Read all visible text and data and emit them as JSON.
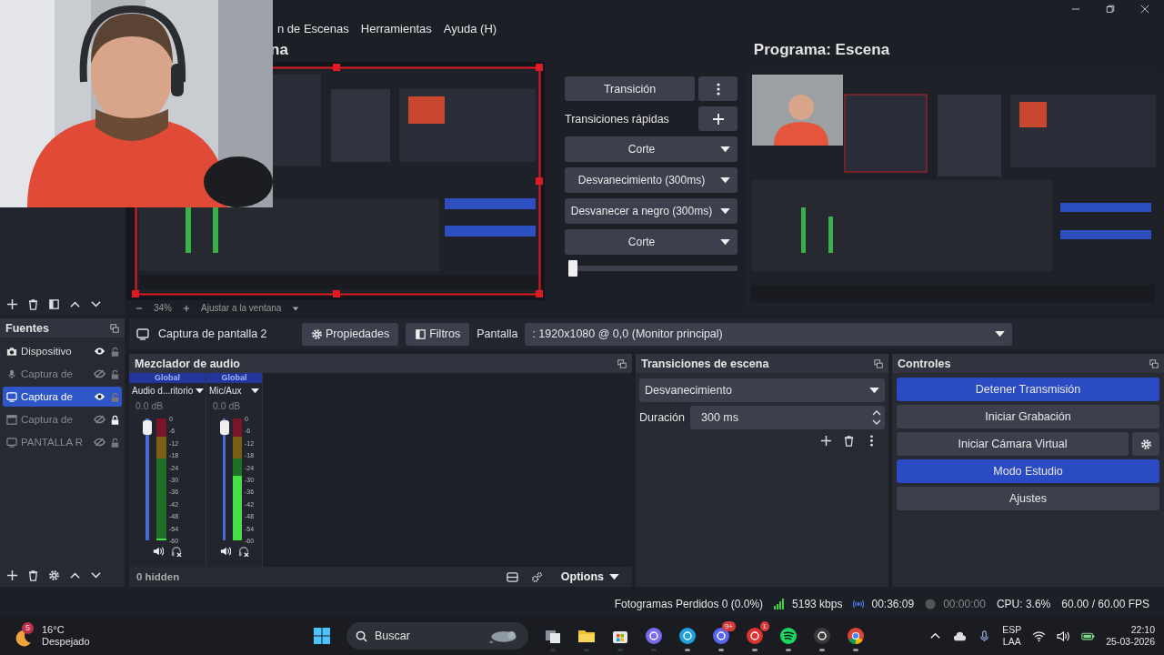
{
  "menu": [
    "n de Escenas",
    "Herramientas",
    "Ayuda (H)"
  ],
  "preview": {
    "title": "na",
    "zoom": "34%",
    "fit": "Ajustar a la ventana"
  },
  "program": {
    "title": "Programa: Escena"
  },
  "studio_transitions": {
    "transition_button": "Transición",
    "quick_label": "Transiciones rápidas",
    "quick": [
      "Corte",
      "Desvanecimiento (300ms)",
      "Desvanecer a negro (300ms)",
      "Corte"
    ],
    "tbar": {
      "level": 0
    }
  },
  "sources": {
    "title": "Fuentes",
    "items": [
      {
        "name": "Dispositivo",
        "kind": "camera",
        "visible": true,
        "locked": false,
        "selected": false
      },
      {
        "name": "Captura de",
        "kind": "mic",
        "visible": false,
        "locked": false,
        "selected": false
      },
      {
        "name": "Captura de",
        "kind": "monitor",
        "visible": true,
        "locked": false,
        "selected": true
      },
      {
        "name": "Captura de",
        "kind": "window",
        "visible": false,
        "locked": true,
        "selected": false
      },
      {
        "name": "PANTALLA R",
        "kind": "monitor",
        "visible": false,
        "locked": false,
        "selected": false
      }
    ]
  },
  "source_bar": {
    "name": "Captura de pantalla 2",
    "properties": "Propiedades",
    "filters": "Filtros",
    "display_label": "Pantalla",
    "display_value": ": 1920x1080 @ 0,0 (Monitor principal)"
  },
  "mixer": {
    "title": "Mezclador de audio",
    "channels": [
      {
        "tag": "Global",
        "name": "Audio d...ritorio",
        "reading": "0.0 dB",
        "fader": {
          "level": 1
        },
        "meter": {
          "level": 0
        },
        "scale": [
          "0",
          "-6",
          "-12",
          "-18",
          "-24",
          "-30",
          "-36",
          "-42",
          "-48",
          "-54",
          "-60"
        ]
      },
      {
        "tag": "Global",
        "name": "Mic/Aux",
        "reading": "0.0 dB",
        "fader": {
          "level": 1
        },
        "meter": {
          "level": 0.53
        },
        "scale": [
          "0",
          "-6",
          "-12",
          "-18",
          "-24",
          "-30",
          "-36",
          "-42",
          "-48",
          "-54",
          "-60"
        ]
      }
    ],
    "hidden": "0 hidden",
    "options": "Options"
  },
  "transitions_dock": {
    "title": "Transiciones de escena",
    "transition": "Desvanecimiento",
    "duration_label": "Duración",
    "duration": "300 ms"
  },
  "controls": {
    "title": "Controles",
    "buttons": [
      {
        "label": "Detener Transmisión",
        "active": true,
        "settings": false
      },
      {
        "label": "Iniciar Grabación",
        "active": false,
        "settings": false
      },
      {
        "label": "Iniciar Cámara Virtual",
        "active": false,
        "settings": true
      },
      {
        "label": "Modo Estudio",
        "active": true,
        "settings": false
      },
      {
        "label": "Ajustes",
        "active": false,
        "settings": false
      }
    ]
  },
  "status_bar": {
    "dropped": "Fotogramas Perdidos 0 (0.0%)",
    "bitrate": "5193 kbps",
    "stream_time": "00:36:09",
    "record_time": "00:00:00",
    "cpu": "CPU: 3.6%",
    "fps": "60.00 / 60.00 FPS"
  },
  "taskbar": {
    "weather": {
      "badge": "5",
      "temp": "16°C",
      "condition": "Despejado"
    },
    "search": "Buscar",
    "apps": [
      {
        "kind": "taskview",
        "running": false
      },
      {
        "kind": "folder",
        "running": false
      },
      {
        "kind": "store",
        "running": false
      },
      {
        "kind": "copilot",
        "running": false
      },
      {
        "kind": "edge",
        "running": true
      },
      {
        "kind": "discord",
        "running": true,
        "badge": "9+"
      },
      {
        "kind": "ea",
        "running": true,
        "badge": "1"
      },
      {
        "kind": "spotify",
        "running": true
      },
      {
        "kind": "obs",
        "running": true
      },
      {
        "kind": "chrome",
        "running": true
      }
    ],
    "lang": "ESP",
    "layout": "LAA",
    "time": "22:10",
    "date": "25-03-2026"
  }
}
